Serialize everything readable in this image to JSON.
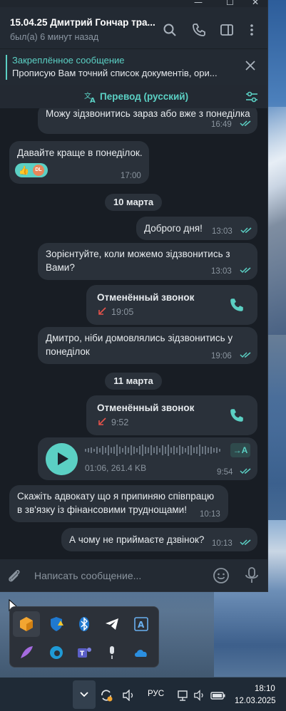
{
  "window": {
    "title": "15.04.25 Дмитрий Гончар тра...",
    "status": "был(а) 6 минут назад"
  },
  "pinned": {
    "title": "Закреплённое сообщение",
    "text": "Прописую Вам точний список документів, ори..."
  },
  "translate": {
    "label": "Перевод (русский)"
  },
  "messages": {
    "m1": {
      "text": "Можу зідзвонитись зараз або вже з понеділка",
      "time": "16:49"
    },
    "m2": {
      "text": "Давайте краще в понеділок.",
      "time": "17:00",
      "reaction_emoji": "👍",
      "reaction_avatar": "DL"
    },
    "date1": "10 марта",
    "m3": {
      "text": "Доброго дня!",
      "time": "13:03"
    },
    "m4": {
      "line1": "Зорієнтуйте, коли можемо зідзвонитись з",
      "line2": "Вами?",
      "time": "13:03"
    },
    "call1": {
      "title": "Отменённый звонок",
      "time": "19:05"
    },
    "m5": {
      "line1": "Дмитро, ніби домовлялись зідзвонитись у",
      "line2": "понеділок",
      "time": "19:06"
    },
    "date2": "11 марта",
    "call2": {
      "title": "Отменённый звонок",
      "time": "9:52"
    },
    "voice": {
      "meta": "01:06, 261.4 KB",
      "time": "9:54",
      "transcribe": "→A"
    },
    "m6": {
      "line1": "Скажіть адвокату що я припиняю співпрацю",
      "line2": "в зв'язку із фінансовими труднощами!",
      "time": "10:13"
    },
    "m7": {
      "text": "А чому не приймаєте дзвінок?",
      "time": "10:13"
    }
  },
  "composer": {
    "placeholder": "Написать сообщение..."
  },
  "taskbar": {
    "lang": "РУС",
    "time": "18:10",
    "date": "12.03.2025"
  },
  "colors": {
    "accent": "#5bd0c4",
    "bubble": "#2a313a",
    "background": "#181d24",
    "header": "#232a33"
  }
}
